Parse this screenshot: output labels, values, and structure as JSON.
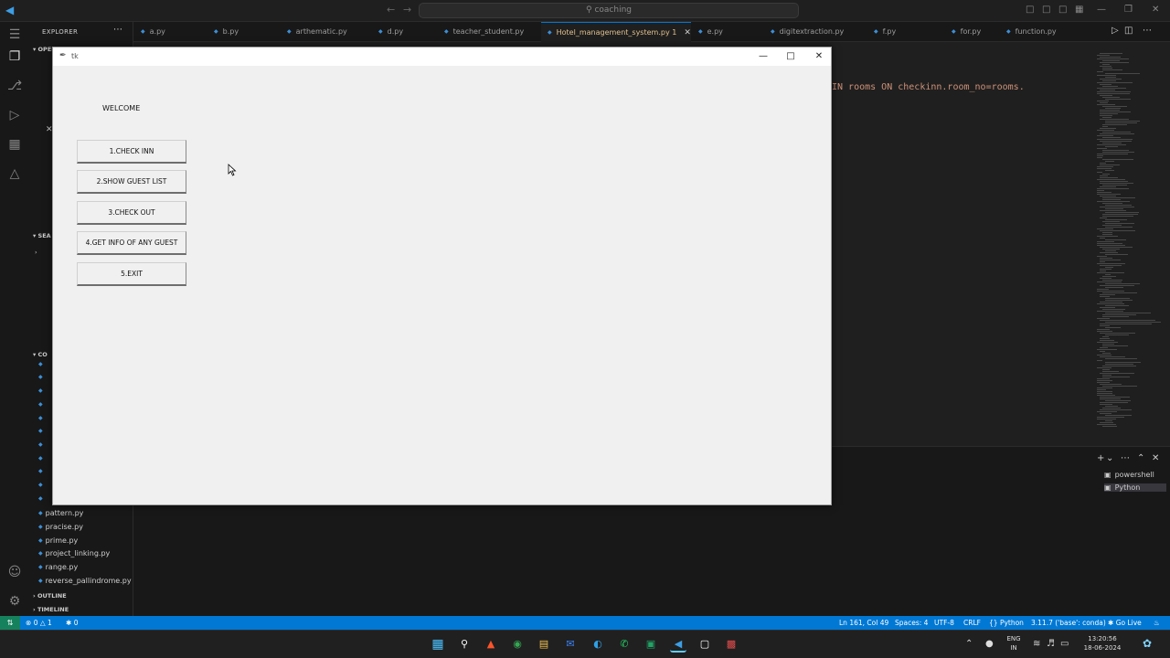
{
  "titlebar": {
    "search_text": "coaching"
  },
  "sidebar": {
    "title": "EXPLORER",
    "section_open": "OPEN...",
    "section_search": "SEA",
    "section_code": "CO",
    "files": [
      "pattern.py",
      "pracise.py",
      "prime.py",
      "project_linking.py",
      "range.py",
      "reverse_pallindrome.py"
    ],
    "outline": "OUTLINE",
    "timeline": "TIMELINE"
  },
  "tabs": [
    {
      "label": "a.py"
    },
    {
      "label": "b.py"
    },
    {
      "label": "arthematic.py"
    },
    {
      "label": "d.py"
    },
    {
      "label": "teacher_student.py"
    },
    {
      "label": "Hotel_management_system.py",
      "modified": "1"
    },
    {
      "label": "e.py"
    },
    {
      "label": "digitextraction.py"
    },
    {
      "label": "f.py"
    },
    {
      "label": "for.py"
    },
    {
      "label": "function.py"
    }
  ],
  "editor": {
    "code_line": "IN rooms ON checkinn.room_no=rooms."
  },
  "panel": {
    "terminals": [
      "powershell",
      "Python"
    ]
  },
  "statusbar": {
    "errors": "0",
    "warnings": "1",
    "ports": "0",
    "position": "Ln 161, Col 49",
    "spaces": "Spaces: 4",
    "encoding": "UTF-8",
    "eol": "CRLF",
    "language": "Python",
    "interpreter": "3.11.7 ('base': conda)",
    "golive": "Go Live"
  },
  "taskbar": {
    "lang_top": "ENG",
    "lang_bottom": "IN",
    "time": "13:20:56",
    "date": "18-06-2024"
  },
  "tkwindow": {
    "title": "tk",
    "welcome": "WELCOME",
    "buttons": [
      "1.CHECK INN",
      "2.SHOW GUEST LIST",
      "3.CHECK OUT",
      "4.GET INFO OF ANY GUEST",
      "5.EXIT"
    ]
  },
  "colors": {
    "accent": "#0078d4",
    "remote": "#16825d",
    "active_tab_text": "#e2c08d",
    "python_icon": "#3c8fd6"
  }
}
